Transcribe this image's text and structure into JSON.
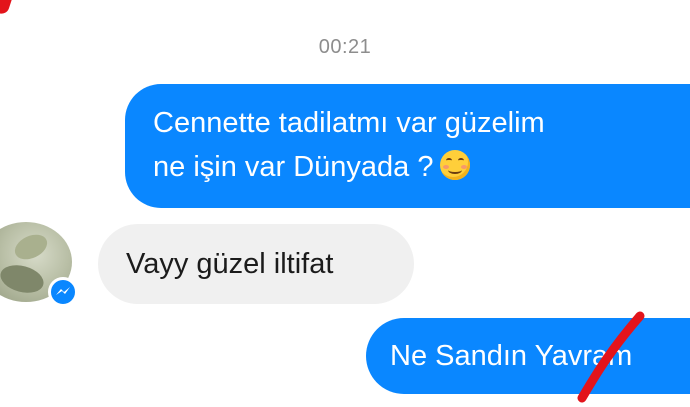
{
  "conversation": {
    "timestamp": "00:21",
    "messages": [
      {
        "direction": "sent",
        "lines": [
          "Cennette tadilatmı var güzelim",
          "ne işin var Dünyada ?"
        ],
        "emoji": "smiling-face-with-blush"
      },
      {
        "direction": "received",
        "text": "Vayy güzel iltifat"
      },
      {
        "direction": "sent",
        "text": "Ne Sandın Yavram"
      }
    ]
  },
  "icons": {
    "avatar": "contact-avatar",
    "badge": "messenger-badge-icon",
    "emoji": "smiling-blush-emoji-icon"
  },
  "colors": {
    "sent_bubble": "#0a87ff",
    "received_bubble": "#f0f0f0",
    "timestamp_text": "#8d8d8d",
    "red_scribble": "#e3141b"
  }
}
